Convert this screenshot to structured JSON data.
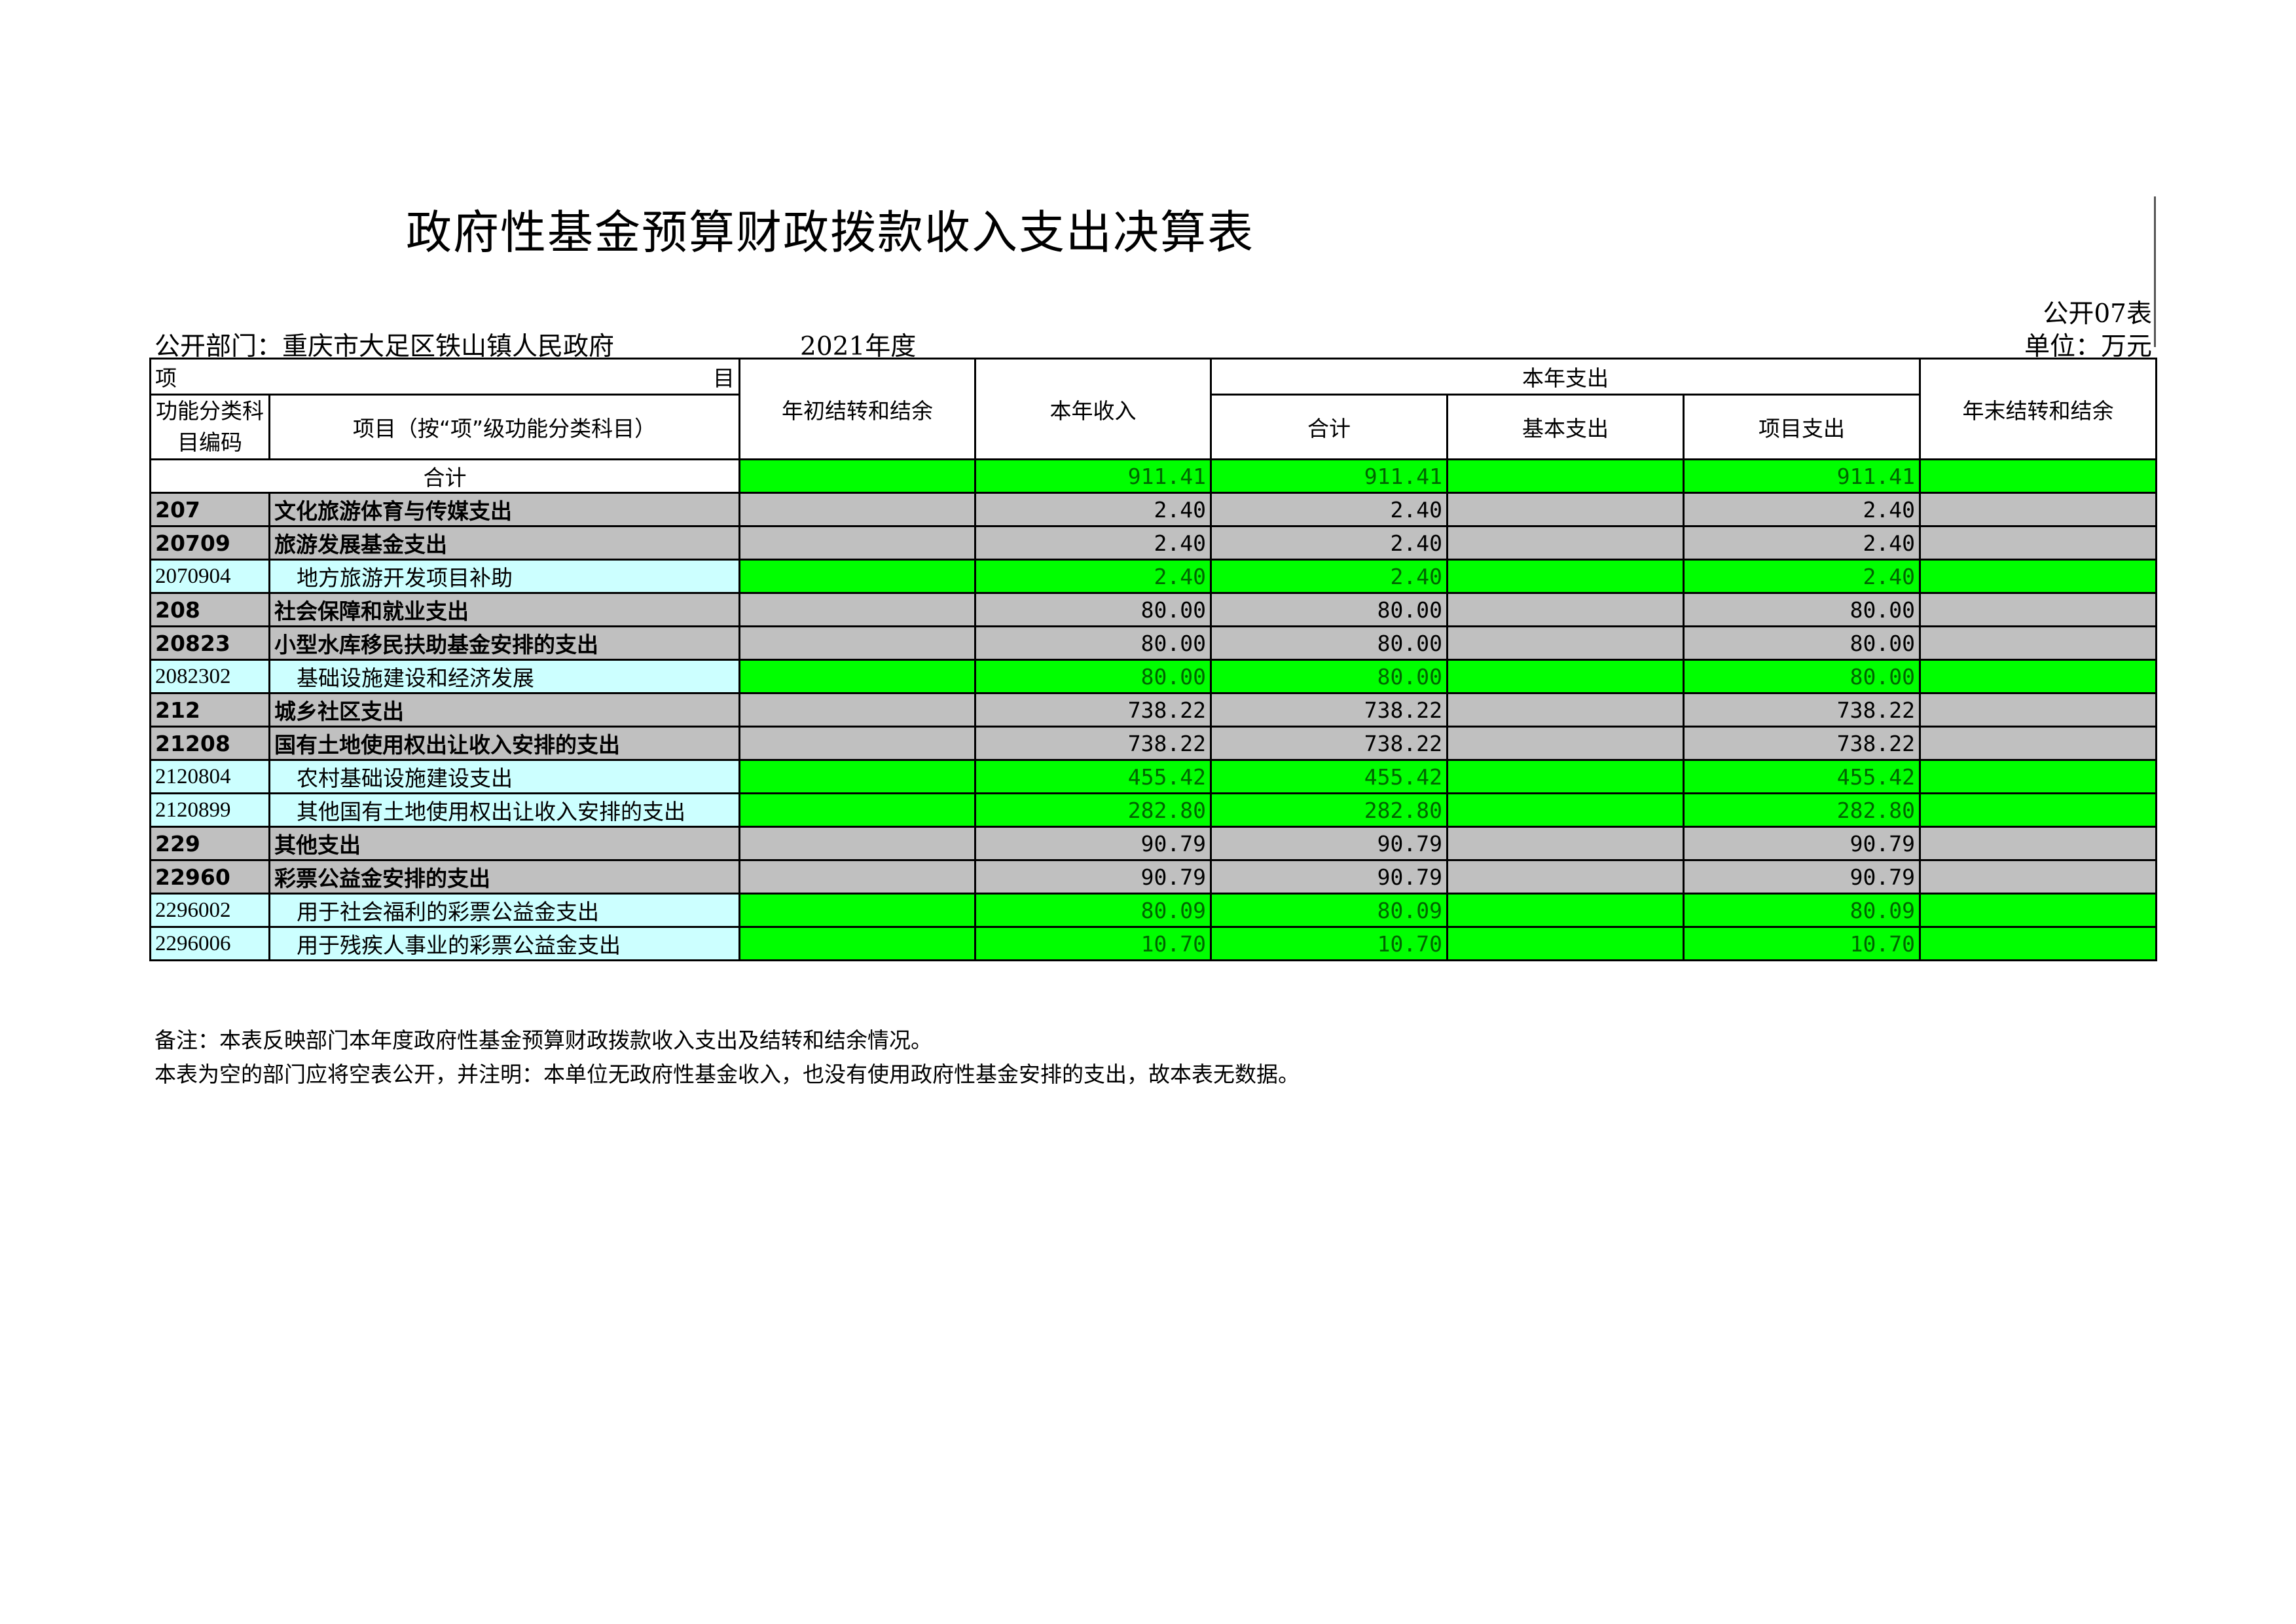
{
  "title": "政府性基金预算财政拨款收入支出决算表",
  "form_no": "公开07表",
  "dept": "公开部门：重庆市大足区铁山镇人民政府",
  "year": "2021年度",
  "unit": "单位：万元",
  "header": {
    "project_left": "项",
    "project_right": "目",
    "code_col": "功能分类科目编码",
    "name_col": "项目（按“项”级功能分类科目）",
    "carry_in": "年初结转和结余",
    "income": "本年收入",
    "expense_group": "本年支出",
    "total": "合计",
    "basic": "基本支出",
    "project_exp": "项目支出",
    "carry_out": "年末结转和结余"
  },
  "total_row": {
    "label": "合计",
    "carry_in": "",
    "income": "911.41",
    "total": "911.41",
    "basic": "",
    "project_exp": "911.41",
    "carry_out": ""
  },
  "rows": [
    {
      "code": "207",
      "name": "文化旅游体育与传媒支出",
      "level": "class",
      "income": "2.40",
      "total": "2.40",
      "basic": "",
      "project_exp": "2.40"
    },
    {
      "code": "20709",
      "name": "旅游发展基金支出",
      "level": "class",
      "income": "2.40",
      "total": "2.40",
      "basic": "",
      "project_exp": "2.40"
    },
    {
      "code": "2070904",
      "name": "地方旅游开发项目补助",
      "level": "item",
      "income": "2.40",
      "total": "2.40",
      "basic": "",
      "project_exp": "2.40"
    },
    {
      "code": "208",
      "name": "社会保障和就业支出",
      "level": "class",
      "income": "80.00",
      "total": "80.00",
      "basic": "",
      "project_exp": "80.00"
    },
    {
      "code": "20823",
      "name": "小型水库移民扶助基金安排的支出",
      "level": "class",
      "income": "80.00",
      "total": "80.00",
      "basic": "",
      "project_exp": "80.00"
    },
    {
      "code": "2082302",
      "name": "基础设施建设和经济发展",
      "level": "item",
      "income": "80.00",
      "total": "80.00",
      "basic": "",
      "project_exp": "80.00"
    },
    {
      "code": "212",
      "name": "城乡社区支出",
      "level": "class",
      "income": "738.22",
      "total": "738.22",
      "basic": "",
      "project_exp": "738.22"
    },
    {
      "code": "21208",
      "name": "国有土地使用权出让收入安排的支出",
      "level": "class",
      "income": "738.22",
      "total": "738.22",
      "basic": "",
      "project_exp": "738.22"
    },
    {
      "code": "2120804",
      "name": "农村基础设施建设支出",
      "level": "item",
      "income": "455.42",
      "total": "455.42",
      "basic": "",
      "project_exp": "455.42"
    },
    {
      "code": "2120899",
      "name": "其他国有土地使用权出让收入安排的支出",
      "level": "item",
      "income": "282.80",
      "total": "282.80",
      "basic": "",
      "project_exp": "282.80"
    },
    {
      "code": "229",
      "name": "其他支出",
      "level": "class",
      "income": "90.79",
      "total": "90.79",
      "basic": "",
      "project_exp": "90.79"
    },
    {
      "code": "22960",
      "name": "彩票公益金安排的支出",
      "level": "class",
      "income": "90.79",
      "total": "90.79",
      "basic": "",
      "project_exp": "90.79"
    },
    {
      "code": "2296002",
      "name": "用于社会福利的彩票公益金支出",
      "level": "item",
      "income": "80.09",
      "total": "80.09",
      "basic": "",
      "project_exp": "80.09"
    },
    {
      "code": "2296006",
      "name": "用于残疾人事业的彩票公益金支出",
      "level": "item",
      "income": "10.70",
      "total": "10.70",
      "basic": "",
      "project_exp": "10.70"
    }
  ],
  "notes": [
    "备注：本表反映部门本年度政府性基金预算财政拨款收入支出及结转和结余情况。",
    "本表为空的部门应将空表公开，并注明：本单位无政府性基金收入，也没有使用政府性基金安排的支出，故本表无数据。"
  ],
  "colors": {
    "green": "#00ff00",
    "grey": "#c0c0c0",
    "cyan": "#ccffff",
    "green_text": "#006400"
  }
}
